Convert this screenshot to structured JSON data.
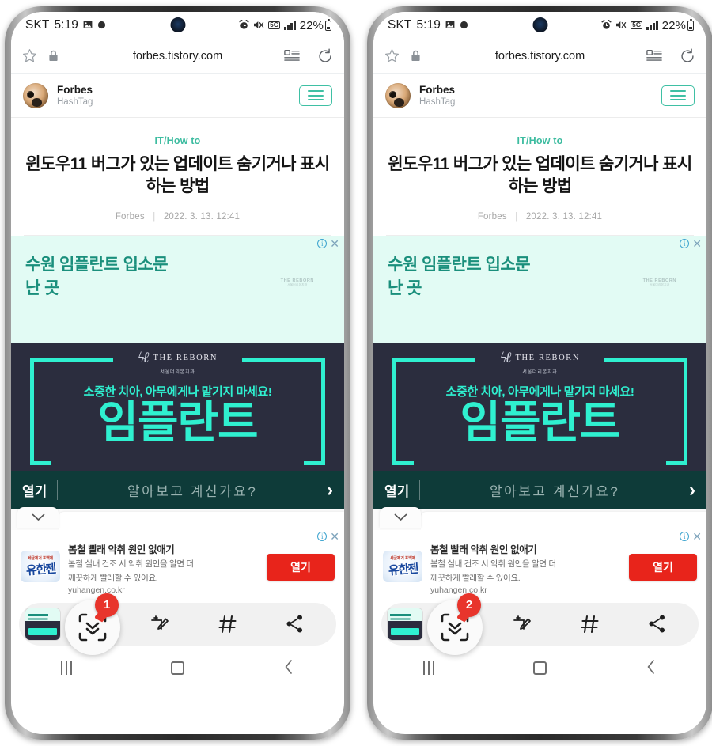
{
  "statusbar": {
    "carrier": "SKT",
    "time": "5:19",
    "screenshot_icon": "image-icon",
    "dot_icon": "dot-icon",
    "alarm_icon": "alarm-icon",
    "mute_icon": "mute-icon",
    "network_type": "5G",
    "signal_icon": "signal-bars-icon",
    "battery_percent": "22%"
  },
  "browser": {
    "bookmark_icon": "star-icon",
    "lock_icon": "lock-icon",
    "url": "forbes.tistory.com",
    "reader_icon": "reader-mode-icon",
    "reload_icon": "reload-icon"
  },
  "blog_header": {
    "avatar": "dog-avatar",
    "title": "Forbes",
    "subtitle": "HashTag",
    "menu_icon": "hamburger-menu-icon"
  },
  "article": {
    "category": "IT/How to",
    "headline": "윈도우11 버그가 있는 업데이트 숨기거나 표시하는 방법",
    "author": "Forbes",
    "separator": "|",
    "date": "2022. 3. 13. 12:41"
  },
  "ad_mint": {
    "line1": "수원 임플란트 입소문",
    "line2": "난 곳",
    "info_icon": "ad-info-icon",
    "info_glyph": "i",
    "close_icon": "ad-close-icon",
    "close_glyph": "✕",
    "watermark_name": "THE REBORN",
    "watermark_sub": "서울더리본치과",
    "bg_color": "#e2fbf4",
    "text_color": "#1a8f7c"
  },
  "ad_dark": {
    "logo_mark": "reborn-logo-icon",
    "logo_name": "THE REBORN",
    "logo_sub": "서울더리본치과",
    "subtitle": "소중한 치아, 아무에게나 맡기지 마세요!",
    "big_text": "임플란트",
    "bg_color": "#2b2d3e",
    "accent_color": "#2ff0d0"
  },
  "ad_cta": {
    "open_label": "열기",
    "message": "알아보고 계신가요?",
    "arrow_icon": "chevron-right-icon",
    "arrow_glyph": "›",
    "bg_color": "#0e3b39"
  },
  "collapse": {
    "icon": "chevron-down-icon",
    "glyph": "⌄"
  },
  "ad_bottom": {
    "brand_logo": "yuhangen-logo",
    "brand_top": "세균제거 표백제",
    "brand_main": "유한젠",
    "title": "봄철 빨래 악취 원인 없애기",
    "desc_line1": "봄철 실내 건조 시 악취 원인을 알면 더",
    "desc_line2": "깨끗하게 빨래할 수 있어요.",
    "url": "yuhangen.co.kr",
    "button_label": "열기",
    "button_color": "#e8241b",
    "info_icon": "ad-info-icon",
    "info_glyph": "i",
    "close_icon": "ad-close-icon",
    "close_glyph": "✕"
  },
  "capture_toolbar": {
    "thumbnail": "capture-thumbnail",
    "scroll_capture_icon": "scroll-capture-icon",
    "crop_edit_icon": "crop-edit-icon",
    "tag_icon": "hashtag-tag-icon",
    "tag_glyph": "#",
    "share_icon": "share-icon"
  },
  "navbar": {
    "recents_icon": "recents-icon",
    "home_icon": "home-icon",
    "back_icon": "back-icon",
    "back_glyph": "‹"
  },
  "annotations": {
    "left_badge": "1",
    "right_badge": "2",
    "badge_color": "#e8352c"
  }
}
